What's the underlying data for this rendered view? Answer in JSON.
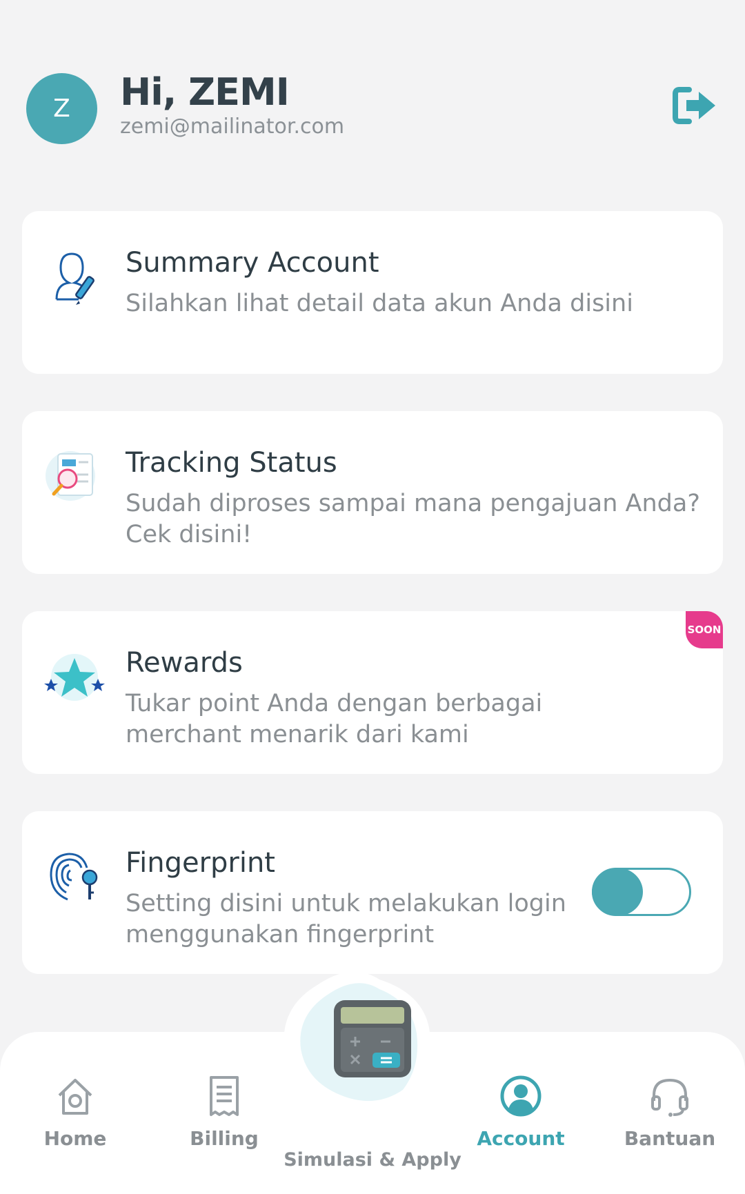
{
  "header": {
    "avatar_initial": "Z",
    "greeting": "Hi, ZEMI",
    "email": "zemi@mailinator.com",
    "logout_icon": "logout-icon"
  },
  "cards": [
    {
      "title": "Summary Account",
      "subtitle": "Silahkan lihat detail data akun Anda disini",
      "icon": "user-edit-icon"
    },
    {
      "title": "Tracking Status",
      "subtitle": "Sudah diproses sampai mana pengajuan Anda? Cek disini!",
      "icon": "document-search-icon"
    },
    {
      "title": "Rewards",
      "subtitle": "Tukar point Anda dengan berbagai merchant menarik dari kami",
      "icon": "star-icon",
      "badge": "SOON"
    },
    {
      "title": "Fingerprint",
      "subtitle": "Setting disini untuk melakukan login menggunakan fingerprint",
      "icon": "fingerprint-icon",
      "toggle_on": true
    }
  ],
  "nav": {
    "home": "Home",
    "billing": "Billing",
    "simulasi": "Simulasi & Apply",
    "account": "Account",
    "bantuan": "Bantuan",
    "active": "account"
  },
  "colors": {
    "accent": "#4aa8b3",
    "badge": "#e63b8c",
    "background": "#f3f3f4"
  }
}
